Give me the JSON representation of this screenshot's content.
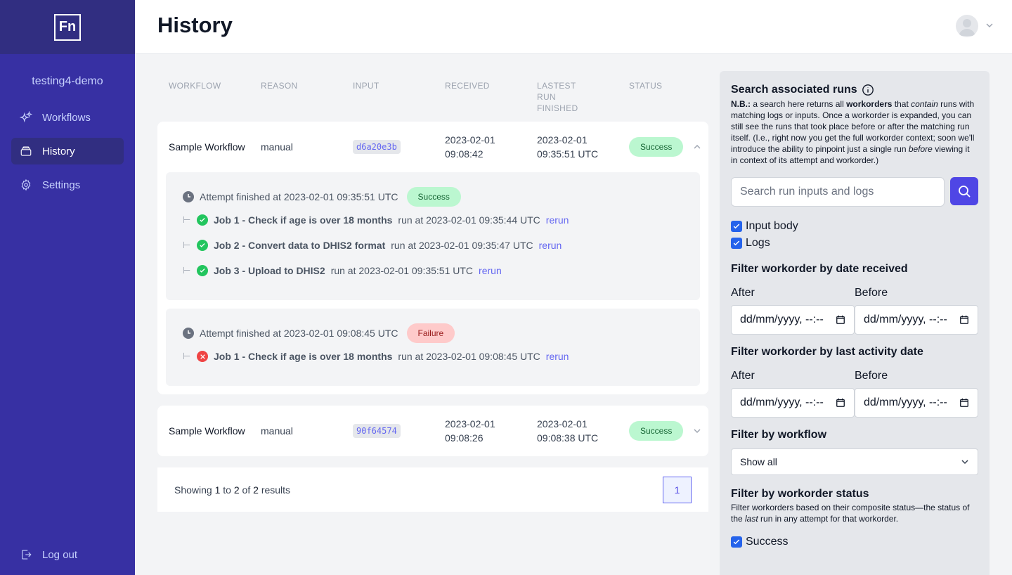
{
  "sidebar": {
    "logo": "Fn",
    "project": "testing4-demo",
    "items": [
      {
        "label": "Workflows",
        "icon": "sparkles-icon",
        "active": false
      },
      {
        "label": "History",
        "icon": "rectangle-stack-icon",
        "active": true
      },
      {
        "label": "Settings",
        "icon": "cog-icon",
        "active": false
      }
    ],
    "logout": "Log out"
  },
  "header": {
    "title": "History"
  },
  "table": {
    "headers": [
      "WORKFLOW",
      "REASON",
      "INPUT",
      "RECEIVED",
      "LASTEST RUN FINISHED",
      "STATUS"
    ],
    "workorders": [
      {
        "workflow": "Sample Workflow",
        "reason": "manual",
        "input": "d6a20e3b",
        "received_date": "2023-02-01",
        "received_time": "09:08:42",
        "finished_date": "2023-02-01",
        "finished_time": "09:35:51 UTC",
        "status": "Success",
        "attempts": [
          {
            "label": "Attempt finished at 2023-02-01 09:35:51 UTC",
            "status": "Success",
            "runs": [
              {
                "job": "Job 1 - Check if age is over 18 months",
                "time": "run at 2023-02-01 09:35:44 UTC",
                "rerun": "rerun"
              },
              {
                "job": "Job 2 - Convert data to DHIS2 format",
                "time": "run at 2023-02-01 09:35:47 UTC",
                "rerun": "rerun"
              },
              {
                "job": "Job 3 - Upload to DHIS2",
                "time": "run at 2023-02-01 09:35:51 UTC",
                "rerun": "rerun"
              }
            ]
          },
          {
            "label": "Attempt finished at 2023-02-01 09:08:45 UTC",
            "status": "Failure",
            "runs": [
              {
                "job": "Job 1 - Check if age is over 18 months",
                "time": "run at 2023-02-01 09:08:45 UTC",
                "rerun": "rerun"
              }
            ]
          }
        ]
      },
      {
        "workflow": "Sample Workflow",
        "reason": "manual",
        "input": "90f64574",
        "received_date": "2023-02-01",
        "received_time": "09:08:26",
        "finished_date": "2023-02-01",
        "finished_time": "09:08:38 UTC",
        "status": "Success"
      }
    ],
    "pagination": {
      "showing": "Showing",
      "from": "1",
      "to_word": "to",
      "to": "2",
      "of_word": "of",
      "total": "2",
      "results_word": "results",
      "page": "1"
    }
  },
  "filters": {
    "search_title": "Search associated runs",
    "nb_lead": "N.B.:",
    "nb_text_1": " a search here returns all ",
    "nb_bold": "workorders",
    "nb_text_2": " that ",
    "nb_italic": "contain",
    "nb_text_3": " runs with matching logs or inputs. Once a workorder is expanded, you can still see the runs that took place before or after the matching run itself. (I.e., right now you get the full workorder context; soon we'll introduce the ability to pinpoint just a single run ",
    "nb_italic2": "before",
    "nb_text_4": " viewing it in context of its attempt and workorder.)",
    "search_placeholder": "Search run inputs and logs",
    "checkbox_input_body": "Input body",
    "checkbox_logs": "Logs",
    "date_received_title": "Filter workorder by date received",
    "last_activity_title": "Filter workorder by last activity date",
    "after_label": "After",
    "before_label": "Before",
    "date_placeholder": "dd/mm/yyyy, --:--",
    "workflow_title": "Filter by workflow",
    "workflow_value": "Show all",
    "status_title": "Filter by workorder status",
    "status_desc_1": "Filter workorders based on their composite status—the status of the ",
    "status_desc_italic": "last",
    "status_desc_2": " run in any attempt for that workorder.",
    "status_success": "Success"
  }
}
